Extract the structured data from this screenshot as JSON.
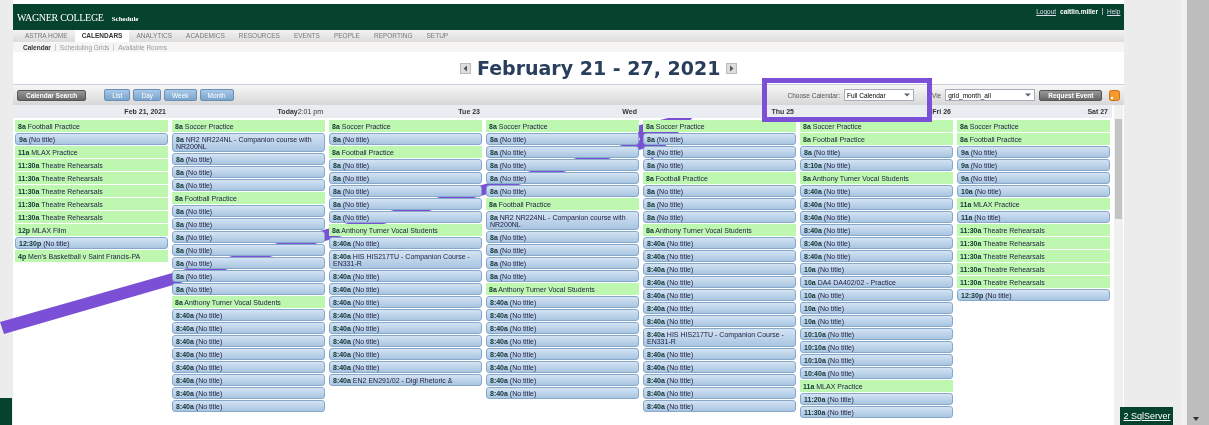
{
  "header": {
    "logo": "WAGNER COLLEGE",
    "app": "Schedule",
    "logout": "Logout",
    "user": "caitlin.miller",
    "help": "Help"
  },
  "tabs": [
    {
      "label": "ASTRA HOME",
      "selected": false
    },
    {
      "label": "CALENDARS",
      "selected": true
    },
    {
      "label": "ANALYTICS",
      "selected": false
    },
    {
      "label": "ACADEMICS",
      "selected": false
    },
    {
      "label": "RESOURCES",
      "selected": false
    },
    {
      "label": "EVENTS",
      "selected": false
    },
    {
      "label": "PEOPLE",
      "selected": false
    },
    {
      "label": "REPORTING",
      "selected": false
    },
    {
      "label": "SETUP",
      "selected": false
    }
  ],
  "subnav": [
    {
      "label": "Calendar",
      "selected": true
    },
    {
      "label": "Scheduling Grids",
      "selected": false
    },
    {
      "label": "Available Rooms",
      "selected": false
    }
  ],
  "title": "February 21 - 27, 2021",
  "toolbar": {
    "search": "Calendar Search",
    "views": [
      {
        "label": "List"
      },
      {
        "label": "Day"
      },
      {
        "label": "Week"
      },
      {
        "label": "Month"
      }
    ],
    "calendar_label": "Choose Calendar:",
    "calendar": "Full Calendar",
    "view_label": "Vie",
    "view": "grid_month_all",
    "request": "Request Event"
  },
  "days": [
    {
      "label": "Feb 21, 2021",
      "events": [
        {
          "time": "8a",
          "title": "Football Practice",
          "kind": "label"
        },
        {
          "time": "9a",
          "title": "(No title)",
          "kind": "block"
        },
        {
          "time": "11a",
          "title": "MLAX Practice",
          "kind": "label"
        },
        {
          "time": "11:30a",
          "title": "Theatre Rehearsals",
          "kind": "label"
        },
        {
          "time": "11:30a",
          "title": "Theatre Rehearsals",
          "kind": "label"
        },
        {
          "time": "11:30a",
          "title": "Theatre Rehearsals",
          "kind": "label"
        },
        {
          "time": "11:30a",
          "title": "Theatre Rehearsals",
          "kind": "label"
        },
        {
          "time": "11:30a",
          "title": "Theatre Rehearsals",
          "kind": "label"
        },
        {
          "time": "12p",
          "title": "MLAX Film",
          "kind": "label"
        },
        {
          "time": "12:30p",
          "title": "(No title)",
          "kind": "block"
        },
        {
          "time": "4p",
          "title": "Men's Basketball v Saint Francis-PA",
          "kind": "label"
        }
      ]
    },
    {
      "label": "Today",
      "note": "2:01 pm",
      "events": [
        {
          "time": "8a",
          "title": "Soccer Practice",
          "kind": "label"
        },
        {
          "time": "8a",
          "title": "NR2 NR224NL - Companion course with NR200NL",
          "kind": "block"
        },
        {
          "time": "8a",
          "title": "(No title)",
          "kind": "block"
        },
        {
          "time": "8a",
          "title": "(No title)",
          "kind": "block"
        },
        {
          "time": "8a",
          "title": "(No title)",
          "kind": "block"
        },
        {
          "time": "8a",
          "title": "Football Practice",
          "kind": "label"
        },
        {
          "time": "8a",
          "title": "(No title)",
          "kind": "block"
        },
        {
          "time": "8a",
          "title": "(No title)",
          "kind": "block"
        },
        {
          "time": "8a",
          "title": "(No title)",
          "kind": "block"
        },
        {
          "time": "8a",
          "title": "(No title)",
          "kind": "block"
        },
        {
          "time": "8a",
          "title": "(No title)",
          "kind": "block"
        },
        {
          "time": "8a",
          "title": "(No title)",
          "kind": "block"
        },
        {
          "time": "8a",
          "title": "(No title)",
          "kind": "block"
        },
        {
          "time": "8a",
          "title": "Anthony Turner Vocal Students",
          "kind": "label"
        },
        {
          "time": "8:40a",
          "title": "(No title)",
          "kind": "block"
        },
        {
          "time": "8:40a",
          "title": "(No title)",
          "kind": "block"
        },
        {
          "time": "8:40a",
          "title": "(No title)",
          "kind": "block"
        },
        {
          "time": "8:40a",
          "title": "(No title)",
          "kind": "block"
        },
        {
          "time": "8:40a",
          "title": "(No title)",
          "kind": "block"
        },
        {
          "time": "8:40a",
          "title": "(No title)",
          "kind": "block"
        },
        {
          "time": "8:40a",
          "title": "(No title)",
          "kind": "block"
        },
        {
          "time": "8:40a",
          "title": "(No title)",
          "kind": "block"
        }
      ]
    },
    {
      "label": "Tue 23",
      "events": [
        {
          "time": "8a",
          "title": "Soccer Practice",
          "kind": "label"
        },
        {
          "time": "8a",
          "title": "(No title)",
          "kind": "block"
        },
        {
          "time": "8a",
          "title": "Football Practice",
          "kind": "label"
        },
        {
          "time": "8a",
          "title": "(No title)",
          "kind": "block"
        },
        {
          "time": "8a",
          "title": "(No title)",
          "kind": "block"
        },
        {
          "time": "8a",
          "title": "(No title)",
          "kind": "block"
        },
        {
          "time": "8a",
          "title": "(No title)",
          "kind": "block"
        },
        {
          "time": "8a",
          "title": "(No title)",
          "kind": "block"
        },
        {
          "time": "8a",
          "title": "Anthony Turner Vocal Students",
          "kind": "label"
        },
        {
          "time": "8:40a",
          "title": "(No title)",
          "kind": "block"
        },
        {
          "time": "8:40a",
          "title": "HIS HIS217TU - Companion Course - EN331-R",
          "kind": "block"
        },
        {
          "time": "8:40a",
          "title": "(No title)",
          "kind": "block"
        },
        {
          "time": "8:40a",
          "title": "(No title)",
          "kind": "block"
        },
        {
          "time": "8:40a",
          "title": "(No title)",
          "kind": "block"
        },
        {
          "time": "8:40a",
          "title": "(No title)",
          "kind": "block"
        },
        {
          "time": "8:40a",
          "title": "(No title)",
          "kind": "block"
        },
        {
          "time": "8:40a",
          "title": "(No title)",
          "kind": "block"
        },
        {
          "time": "8:40a",
          "title": "(No title)",
          "kind": "block"
        },
        {
          "time": "8:40a",
          "title": "(No title)",
          "kind": "block"
        },
        {
          "time": "8:40a",
          "title": "EN2 EN291/02 - Digi Rhetoric &",
          "kind": "block"
        }
      ]
    },
    {
      "label": "Wed",
      "events": [
        {
          "time": "8a",
          "title": "Soccer Practice",
          "kind": "label"
        },
        {
          "time": "8a",
          "title": "(No title)",
          "kind": "block"
        },
        {
          "time": "8a",
          "title": "(No title)",
          "kind": "block"
        },
        {
          "time": "8a",
          "title": "(No title)",
          "kind": "block"
        },
        {
          "time": "8a",
          "title": "(No title)",
          "kind": "block"
        },
        {
          "time": "8a",
          "title": "(No title)",
          "kind": "block"
        },
        {
          "time": "8a",
          "title": "Football Practice",
          "kind": "label"
        },
        {
          "time": "8a",
          "title": "NR2 NR224NL - Companion course with NR200NL",
          "kind": "block"
        },
        {
          "time": "8a",
          "title": "(No title)",
          "kind": "block"
        },
        {
          "time": "8a",
          "title": "(No title)",
          "kind": "block"
        },
        {
          "time": "8a",
          "title": "(No title)",
          "kind": "block"
        },
        {
          "time": "8a",
          "title": "(No title)",
          "kind": "block"
        },
        {
          "time": "8a",
          "title": "Anthony Turner Vocal Students",
          "kind": "label"
        },
        {
          "time": "8:40a",
          "title": "(No title)",
          "kind": "block"
        },
        {
          "time": "8:40a",
          "title": "(No title)",
          "kind": "block"
        },
        {
          "time": "8:40a",
          "title": "(No title)",
          "kind": "block"
        },
        {
          "time": "8:40a",
          "title": "(No title)",
          "kind": "block"
        },
        {
          "time": "8:40a",
          "title": "(No title)",
          "kind": "block"
        },
        {
          "time": "8:40a",
          "title": "(No title)",
          "kind": "block"
        },
        {
          "time": "8:40a",
          "title": "(No title)",
          "kind": "block"
        },
        {
          "time": "8:40a",
          "title": "(No title)",
          "kind": "block"
        }
      ]
    },
    {
      "label": "Thu 25",
      "events": [
        {
          "time": "8a",
          "title": "Soccer Practice",
          "kind": "label"
        },
        {
          "time": "8a",
          "title": "(No title)",
          "kind": "block"
        },
        {
          "time": "8a",
          "title": "(No title)",
          "kind": "block"
        },
        {
          "time": "8a",
          "title": "(No title)",
          "kind": "block"
        },
        {
          "time": "8a",
          "title": "Football Practice",
          "kind": "label"
        },
        {
          "time": "8a",
          "title": "(No title)",
          "kind": "block"
        },
        {
          "time": "8a",
          "title": "(No title)",
          "kind": "block"
        },
        {
          "time": "8a",
          "title": "(No title)",
          "kind": "block"
        },
        {
          "time": "8a",
          "title": "Anthony Turner Vocal Students",
          "kind": "label"
        },
        {
          "time": "8:40a",
          "title": "(No title)",
          "kind": "block"
        },
        {
          "time": "8:40a",
          "title": "(No title)",
          "kind": "block"
        },
        {
          "time": "8:40a",
          "title": "(No title)",
          "kind": "block"
        },
        {
          "time": "8:40a",
          "title": "(No title)",
          "kind": "block"
        },
        {
          "time": "8:40a",
          "title": "(No title)",
          "kind": "block"
        },
        {
          "time": "8:40a",
          "title": "(No title)",
          "kind": "block"
        },
        {
          "time": "8:40a",
          "title": "(No title)",
          "kind": "block"
        },
        {
          "time": "8:40a",
          "title": "HIS HIS217TU - Companion Course - EN331-R",
          "kind": "block"
        },
        {
          "time": "8:40a",
          "title": "(No title)",
          "kind": "block"
        },
        {
          "time": "8:40a",
          "title": "(No title)",
          "kind": "block"
        },
        {
          "time": "8:40a",
          "title": "(No title)",
          "kind": "block"
        },
        {
          "time": "8:40a",
          "title": "(No title)",
          "kind": "block"
        },
        {
          "time": "8:40a",
          "title": "(No title)",
          "kind": "block"
        }
      ]
    },
    {
      "label": "Fri 26",
      "events": [
        {
          "time": "8a",
          "title": "Soccer Practice",
          "kind": "label"
        },
        {
          "time": "8a",
          "title": "Football Practice",
          "kind": "label"
        },
        {
          "time": "8a",
          "title": "(No title)",
          "kind": "block"
        },
        {
          "time": "8:10a",
          "title": "(No title)",
          "kind": "block"
        },
        {
          "time": "8a",
          "title": "Anthony Turner Vocal Students",
          "kind": "label"
        },
        {
          "time": "8:40a",
          "title": "(No title)",
          "kind": "block"
        },
        {
          "time": "8:40a",
          "title": "(No title)",
          "kind": "block"
        },
        {
          "time": "8:40a",
          "title": "(No title)",
          "kind": "block"
        },
        {
          "time": "8:40a",
          "title": "(No title)",
          "kind": "block"
        },
        {
          "time": "8:40a",
          "title": "(No title)",
          "kind": "block"
        },
        {
          "time": "8:40a",
          "title": "(No title)",
          "kind": "block"
        },
        {
          "time": "10a",
          "title": "(No title)",
          "kind": "block"
        },
        {
          "time": "10a",
          "title": "DA4 DA402/02 - Practice",
          "kind": "block"
        },
        {
          "time": "10a",
          "title": "(No title)",
          "kind": "block"
        },
        {
          "time": "10a",
          "title": "(No title)",
          "kind": "block"
        },
        {
          "time": "10a",
          "title": "(No title)",
          "kind": "block"
        },
        {
          "time": "10:10a",
          "title": "(No title)",
          "kind": "block"
        },
        {
          "time": "10:10a",
          "title": "(No title)",
          "kind": "block"
        },
        {
          "time": "10:10a",
          "title": "(No title)",
          "kind": "block"
        },
        {
          "time": "10:40a",
          "title": "(No title)",
          "kind": "block"
        },
        {
          "time": "11a",
          "title": "MLAX Practice",
          "kind": "label"
        },
        {
          "time": "11:20a",
          "title": "(No title)",
          "kind": "block"
        },
        {
          "time": "11:30a",
          "title": "(No title)",
          "kind": "block"
        }
      ]
    },
    {
      "label": "Sat 27",
      "events": [
        {
          "time": "8a",
          "title": "Soccer Practice",
          "kind": "label"
        },
        {
          "time": "8a",
          "title": "Football Practice",
          "kind": "label"
        },
        {
          "time": "9a",
          "title": "(No title)",
          "kind": "block"
        },
        {
          "time": "9a",
          "title": "(No title)",
          "kind": "block"
        },
        {
          "time": "9a",
          "title": "(No title)",
          "kind": "block"
        },
        {
          "time": "10a",
          "title": "(No title)",
          "kind": "block"
        },
        {
          "time": "11a",
          "title": "MLAX Practice",
          "kind": "label"
        },
        {
          "time": "11a",
          "title": "(No title)",
          "kind": "block"
        },
        {
          "time": "11:30a",
          "title": "Theatre Rehearsals",
          "kind": "label"
        },
        {
          "time": "11:30a",
          "title": "Theatre Rehearsals",
          "kind": "label"
        },
        {
          "time": "11:30a",
          "title": "Theatre Rehearsals",
          "kind": "label"
        },
        {
          "time": "11:30a",
          "title": "Theatre Rehearsals",
          "kind": "label"
        },
        {
          "time": "11:30a",
          "title": "Theatre Rehearsals",
          "kind": "label"
        },
        {
          "time": "12:30p",
          "title": "(No title)",
          "kind": "block"
        }
      ]
    }
  ],
  "footer_link": "2 SqlServer"
}
